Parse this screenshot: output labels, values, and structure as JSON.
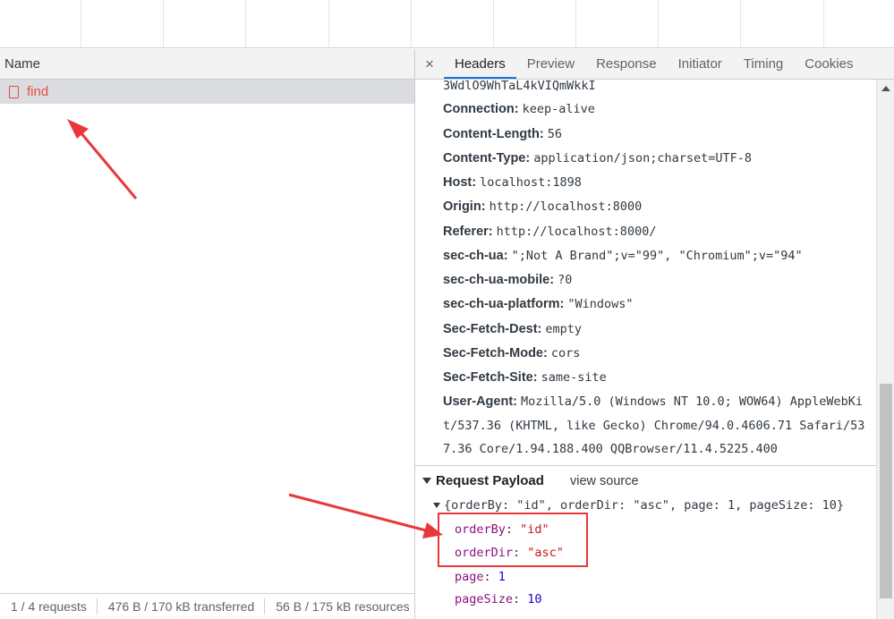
{
  "left_pane": {
    "column_header": "Name",
    "requests": [
      {
        "name": "find"
      }
    ],
    "status": {
      "requests": "1 / 4 requests",
      "transferred": "476 B / 170 kB transferred",
      "resources": "56 B / 175 kB resources"
    }
  },
  "right_pane": {
    "close_label": "×",
    "tabs": [
      "Headers",
      "Preview",
      "Response",
      "Initiator",
      "Timing",
      "Cookies"
    ],
    "active_tab": "Headers",
    "headers": {
      "partial_top": "3WdlO9WhTaL4kVIQmWkkI",
      "rows": [
        {
          "name": "Connection:",
          "value": "keep-alive"
        },
        {
          "name": "Content-Length:",
          "value": "56"
        },
        {
          "name": "Content-Type:",
          "value": "application/json;charset=UTF-8"
        },
        {
          "name": "Host:",
          "value": "localhost:1898"
        },
        {
          "name": "Origin:",
          "value": "http://localhost:8000"
        },
        {
          "name": "Referer:",
          "value": "http://localhost:8000/"
        },
        {
          "name": "sec-ch-ua:",
          "value": "\";Not A Brand\";v=\"99\", \"Chromium\";v=\"94\""
        },
        {
          "name": "sec-ch-ua-mobile:",
          "value": "?0"
        },
        {
          "name": "sec-ch-ua-platform:",
          "value": "\"Windows\""
        },
        {
          "name": "Sec-Fetch-Dest:",
          "value": "empty"
        },
        {
          "name": "Sec-Fetch-Mode:",
          "value": "cors"
        },
        {
          "name": "Sec-Fetch-Site:",
          "value": "same-site"
        },
        {
          "name": "User-Agent:",
          "value": "Mozilla/5.0 (Windows NT 10.0; WOW64) AppleWebKi"
        }
      ],
      "ua_cont_1": "t/537.36 (KHTML, like Gecko) Chrome/94.0.4606.71 Safari/53",
      "ua_cont_2": "7.36 Core/1.94.188.400 QQBrowser/11.4.5225.400"
    },
    "payload": {
      "title": "Request Payload",
      "view_source": "view source",
      "summary": "{orderBy: \"id\", orderDir: \"asc\", page: 1, pageSize: 10}",
      "props": [
        {
          "key": "orderBy",
          "value": "\"id\"",
          "kind": "str"
        },
        {
          "key": "orderDir",
          "value": "\"asc\"",
          "kind": "str"
        },
        {
          "key": "page",
          "value": "1",
          "kind": "num"
        },
        {
          "key": "pageSize",
          "value": "10",
          "kind": "num"
        }
      ]
    }
  },
  "colors": {
    "accent": "#1a73e8",
    "annotation_red": "#e8383b",
    "error_red": "#e84c3d",
    "json_key": "#881280",
    "json_string": "#c41a16",
    "json_number": "#1c00cf"
  }
}
